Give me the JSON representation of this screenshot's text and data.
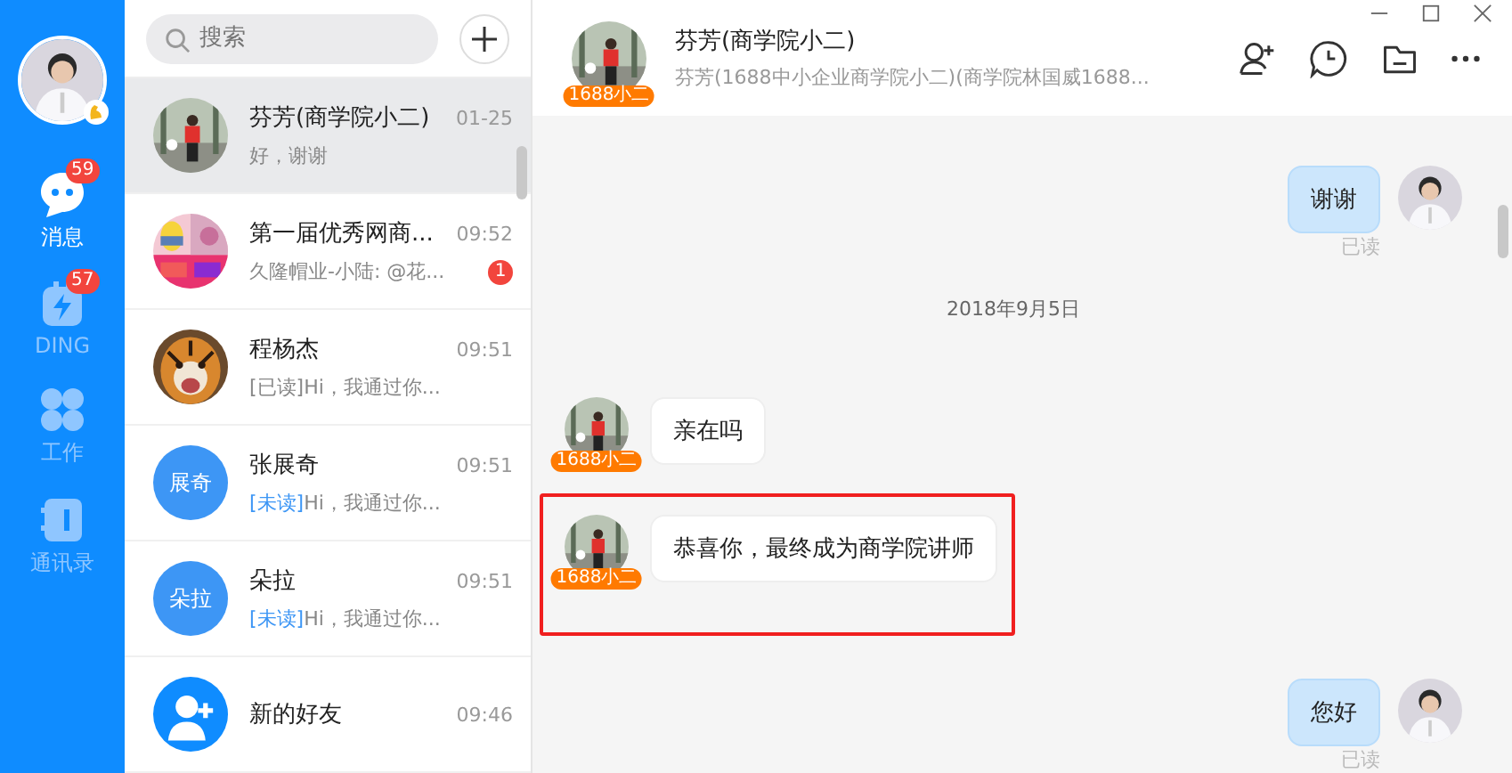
{
  "nav": {
    "items": [
      {
        "label": "消息",
        "kind": "chat",
        "badge": "59",
        "selected": true
      },
      {
        "label": "DING",
        "kind": "ding",
        "badge": "57",
        "selected": false
      },
      {
        "label": "工作",
        "kind": "grid",
        "selected": false
      },
      {
        "label": "通讯录",
        "kind": "book",
        "selected": false
      }
    ]
  },
  "search": {
    "placeholder": "搜索"
  },
  "conversations": [
    {
      "name": "芬芳(商学院小二)",
      "time": "01-25",
      "preview": "好，谢谢",
      "selected": true
    },
    {
      "name": "第一届优秀网商...",
      "time": "09:52",
      "preview": "久隆帽业-小陆: @花...",
      "unread": "1",
      "selected": false
    },
    {
      "name": "程杨杰",
      "time": "09:51",
      "tag": {
        "text": "[已读]",
        "unread": false
      },
      "preview": "Hi，我通过你...",
      "selected": false
    },
    {
      "name": "张展奇",
      "time": "09:51",
      "tag": {
        "text": "[未读]",
        "unread": true
      },
      "preview": "Hi，我通过你...",
      "avatar": {
        "kind": "initials",
        "text": "展奇"
      },
      "selected": false
    },
    {
      "name": "朵拉",
      "time": "09:51",
      "tag": {
        "text": "[未读]",
        "unread": true
      },
      "preview": "Hi，我通过你...",
      "avatar": {
        "kind": "initials",
        "text": "朵拉"
      },
      "selected": false
    },
    {
      "name": "新的好友",
      "time": "09:46",
      "avatar": {
        "kind": "icon"
      },
      "selected": false
    }
  ],
  "chat": {
    "title": "芬芳(商学院小二)",
    "subtitle": "芬芳(1688中小企业商学院小二)(商学院林国威1688...",
    "badge": "1688小二",
    "messages": [
      {
        "kind": "outgoing",
        "text": "谢谢",
        "status": "已读"
      },
      {
        "kind": "date",
        "text": "2018年9月5日"
      },
      {
        "kind": "incoming",
        "text": "亲在吗",
        "badge": "1688小二",
        "highlighted": false
      },
      {
        "kind": "incoming",
        "text": "恭喜你，最终成为商学院讲师",
        "badge": "1688小二",
        "highlighted": true
      },
      {
        "kind": "outgoing",
        "text": "您好",
        "status": "已读"
      }
    ]
  }
}
